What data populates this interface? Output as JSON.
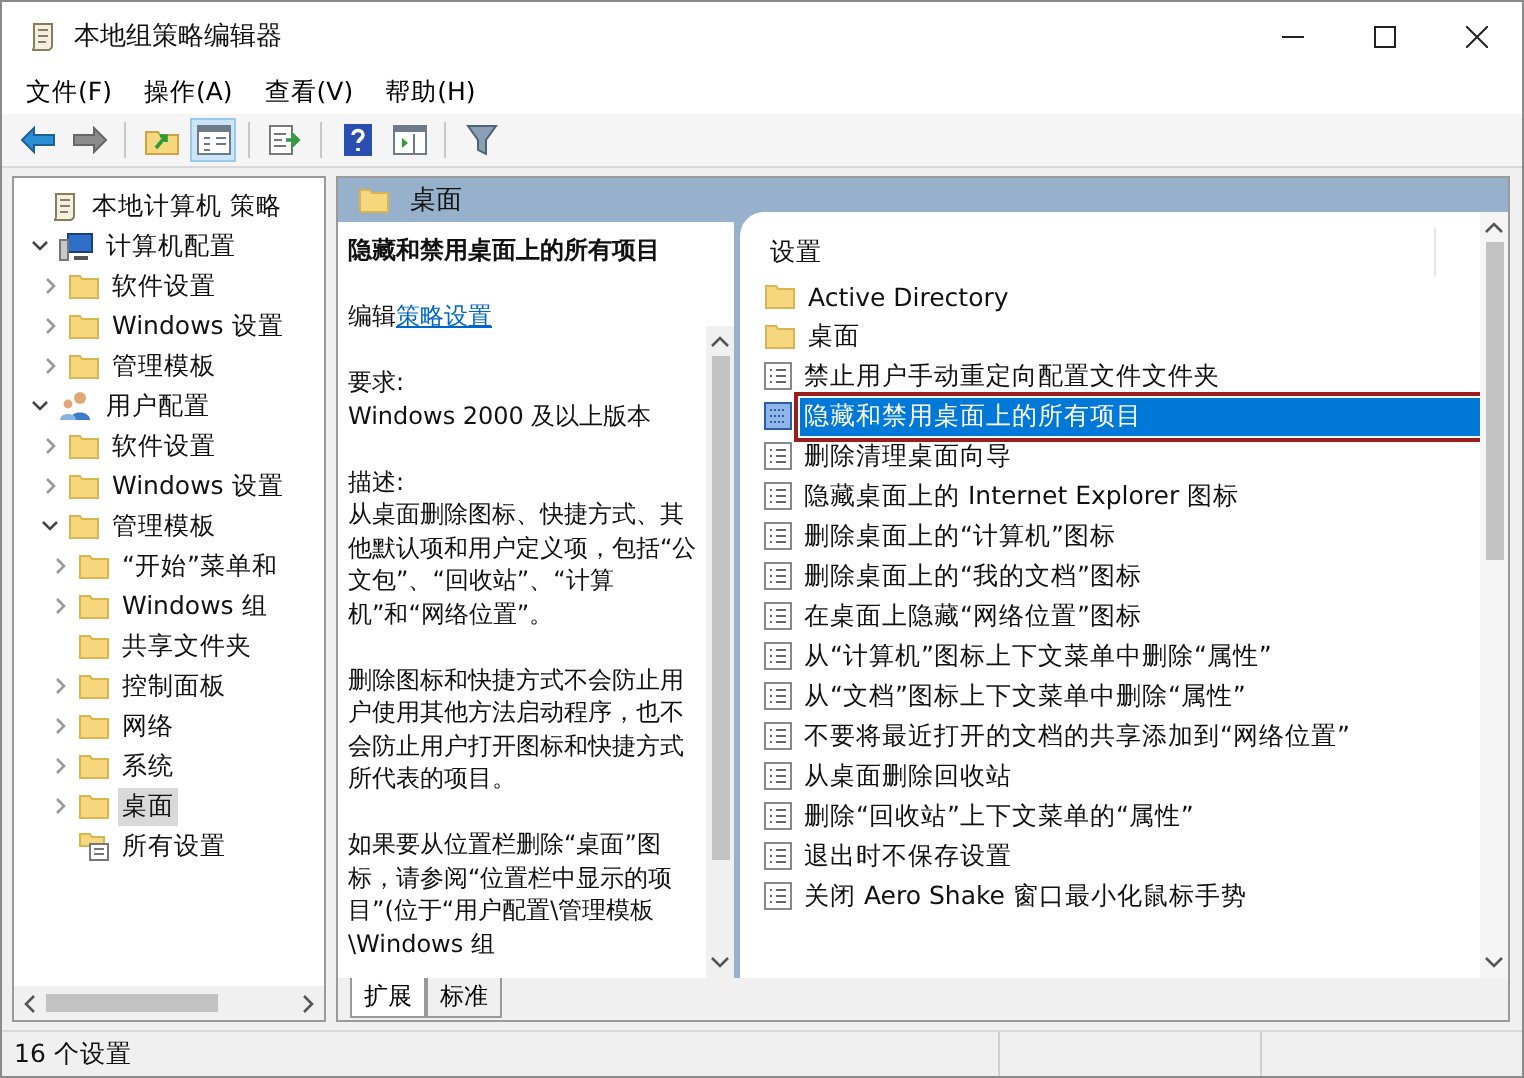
{
  "window": {
    "title": "本地组策略编辑器"
  },
  "menu": [
    {
      "label": "文件(F)"
    },
    {
      "label": "操作(A)"
    },
    {
      "label": "查看(V)"
    },
    {
      "label": "帮助(H)"
    }
  ],
  "toolbar": [
    [
      {
        "kind": "back",
        "pressed": false
      },
      {
        "kind": "forward",
        "pressed": false
      }
    ],
    [
      {
        "kind": "up",
        "pressed": false
      },
      {
        "kind": "tree",
        "pressed": true
      }
    ],
    [
      {
        "kind": "export",
        "pressed": false
      }
    ],
    [
      {
        "kind": "help",
        "pressed": false
      },
      {
        "kind": "pane",
        "pressed": false
      }
    ],
    [
      {
        "kind": "filter",
        "pressed": false
      }
    ]
  ],
  "tree": [
    {
      "label": "本地计算机 策略",
      "kind": "policy",
      "selected": false,
      "children": [
        {
          "label": "计算机配置",
          "kind": "computer",
          "expanded": true,
          "selected": false,
          "children": [
            {
              "label": "软件设置",
              "kind": "folder",
              "expanded": false,
              "selected": false
            },
            {
              "label": "Windows 设置",
              "kind": "folder",
              "expanded": false,
              "selected": false
            },
            {
              "label": "管理模板",
              "kind": "folder",
              "expanded": false,
              "selected": false
            }
          ]
        },
        {
          "label": "用户配置",
          "kind": "user",
          "expanded": true,
          "selected": false,
          "children": [
            {
              "label": "软件设置",
              "kind": "folder",
              "expanded": false,
              "selected": false
            },
            {
              "label": "Windows 设置",
              "kind": "folder",
              "expanded": false,
              "selected": false
            },
            {
              "label": "管理模板",
              "kind": "folder",
              "expanded": true,
              "selected": false,
              "children": [
                {
                  "label": "“开始”菜单和",
                  "kind": "folder",
                  "expanded": false,
                  "selected": false
                },
                {
                  "label": "Windows 组",
                  "kind": "folder",
                  "expanded": false,
                  "selected": false
                },
                {
                  "label": "共享文件夹",
                  "kind": "folder",
                  "selected": false
                },
                {
                  "label": "控制面板",
                  "kind": "folder",
                  "expanded": false,
                  "selected": false
                },
                {
                  "label": "网络",
                  "kind": "folder",
                  "expanded": false,
                  "selected": false
                },
                {
                  "label": "系统",
                  "kind": "folder",
                  "expanded": false,
                  "selected": false
                },
                {
                  "label": "桌面",
                  "kind": "folder",
                  "expanded": false,
                  "selected": true
                },
                {
                  "label": "所有设置",
                  "kind": "allsettings",
                  "selected": false
                }
              ]
            }
          ]
        }
      ]
    }
  ],
  "header": {
    "title": "桌面"
  },
  "description": {
    "title": "隐藏和禁用桌面上的所有项目",
    "edit_prefix": "编辑",
    "edit_link": "策略设置",
    "requirements_label": "要求:",
    "requirements": "Windows 2000 及以上版本",
    "description_label": "描述:",
    "paragraphs": [
      "从桌面删除图标、快捷方式、其他默认项和用户定义项，包括“公文包”、“回收站”、“计算机”和“网络位置”。",
      "删除图标和快捷方式不会防止用户使用其他方法启动程序，也不会防止用户打开图标和快捷方式所代表的项目。",
      "如果要从位置栏删除“桌面”图标，请参阅“位置栏中显示的项目”(位于“用户配置\\管理模板\\Windows 组"
    ]
  },
  "list": {
    "column": "设置",
    "items": [
      {
        "label": "Active Directory",
        "kind": "folder",
        "selected": false,
        "annotated": false
      },
      {
        "label": "桌面",
        "kind": "folder",
        "selected": false,
        "annotated": false
      },
      {
        "label": "禁止用户手动重定向配置文件文件夹",
        "kind": "setting",
        "selected": false,
        "annotated": false
      },
      {
        "label": "隐藏和禁用桌面上的所有项目",
        "kind": "setting",
        "selected": true,
        "annotated": true
      },
      {
        "label": "删除清理桌面向导",
        "kind": "setting",
        "selected": false,
        "annotated": false
      },
      {
        "label": "隐藏桌面上的 Internet Explorer 图标",
        "kind": "setting",
        "selected": false,
        "annotated": false
      },
      {
        "label": "删除桌面上的“计算机”图标",
        "kind": "setting",
        "selected": false,
        "annotated": false
      },
      {
        "label": "删除桌面上的“我的文档”图标",
        "kind": "setting",
        "selected": false,
        "annotated": false
      },
      {
        "label": "在桌面上隐藏“网络位置”图标",
        "kind": "setting",
        "selected": false,
        "annotated": false
      },
      {
        "label": "从“计算机”图标上下文菜单中删除“属性”",
        "kind": "setting",
        "selected": false,
        "annotated": false
      },
      {
        "label": "从“文档”图标上下文菜单中删除“属性”",
        "kind": "setting",
        "selected": false,
        "annotated": false
      },
      {
        "label": "不要将最近打开的文档的共享添加到“网络位置”",
        "kind": "setting",
        "selected": false,
        "annotated": false
      },
      {
        "label": "从桌面删除回收站",
        "kind": "setting",
        "selected": false,
        "annotated": false
      },
      {
        "label": "删除“回收站”上下文菜单的“属性”",
        "kind": "setting",
        "selected": false,
        "annotated": false
      },
      {
        "label": "退出时不保存设置",
        "kind": "setting",
        "selected": false,
        "annotated": false
      },
      {
        "label": "关闭 Aero Shake 窗口最小化鼠标手势",
        "kind": "setting",
        "selected": false,
        "annotated": false
      }
    ]
  },
  "view_tabs": [
    {
      "label": "扩展",
      "selected": true
    },
    {
      "label": "标准",
      "selected": false
    }
  ],
  "status_bar": {
    "text": "16 个设置"
  }
}
